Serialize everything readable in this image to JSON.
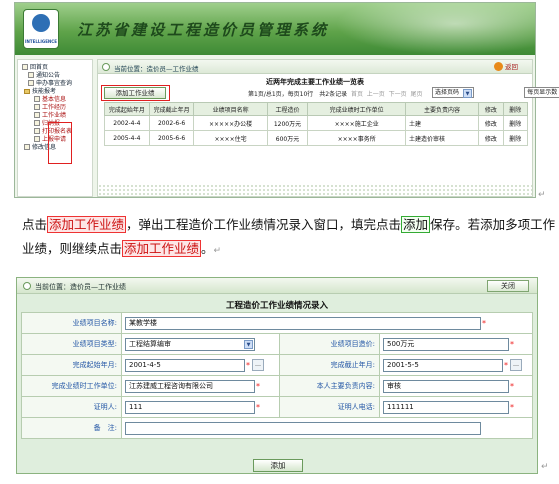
{
  "top_screenshot": {
    "title": "江苏省建设工程造价员管理系统",
    "logo_text": "INTELLIGENCE",
    "sidebar": {
      "items": [
        {
          "label": "回首页"
        },
        {
          "label": "通知公告"
        },
        {
          "label": "申办事宜查询"
        },
        {
          "label": "技能报考"
        },
        {
          "label": "基本信息"
        },
        {
          "label": "工作经历"
        },
        {
          "label": "工作业绩"
        },
        {
          "label": "归纳报"
        },
        {
          "label": "打印报名表"
        },
        {
          "label": "上报申请"
        },
        {
          "label": "修改信息"
        }
      ]
    },
    "breadcrumb": "当前位置：造价员—工作业绩",
    "back_label": "返回",
    "list_title": "近两年完成主要工作业绩一览表",
    "add_button": "添加工作业绩",
    "pager": {
      "info": "第1页/总1页，每页10行　共2条记录",
      "first": "首页",
      "prev": "上一页",
      "next": "下一页",
      "last": "尾页",
      "page_select": "选择页码",
      "page_size": "每页显示数"
    },
    "table": {
      "headers": [
        "完成起始年月",
        "完成截止年月",
        "业绩项目名称",
        "工程造价",
        "完成业绩时工作单位",
        "主要负责内容",
        "修改",
        "删除"
      ],
      "rows": [
        [
          "2002-4-4",
          "2002-6-6",
          "×××××办公楼",
          "1200万元",
          "××××施工企业",
          "土建",
          "修改",
          "删除"
        ],
        [
          "2005-4-4",
          "2005-6-6",
          "××××住宅",
          "600万元",
          "××××事务所",
          "土建造价审核",
          "修改",
          "删除"
        ]
      ]
    }
  },
  "paragraph": {
    "p1": "点击",
    "h1": "添加工作业绩",
    "p2": "，弹出工程造价工作业绩情况录入窗口，填完点击",
    "h2": "添加",
    "p3": "保存。若添加多项工作业绩，则继续点击",
    "h3": "添加工作业绩",
    "p4": "。"
  },
  "bottom_screenshot": {
    "breadcrumb": "当前位置：造价员—工作业绩",
    "close_label": "关闭",
    "form_title": "工程造价工作业绩情况录入",
    "fields": {
      "project_name_label": "业绩项目名称:",
      "project_name_value": "某教学楼",
      "project_type_label": "业绩项目类型:",
      "project_type_value": "工程结算编审",
      "project_cost_label": "业绩项目造价:",
      "project_cost_value": "500万元",
      "start_label": "完成起始年月:",
      "start_value": "2001-4-5",
      "end_label": "完成截止年月:",
      "end_value": "2001-5-5",
      "unit_label": "完成业绩时工作单位:",
      "unit_value": "江苏建威工程咨询有限公司",
      "duty_label": "本人主要负责内容:",
      "duty_value": "审核",
      "witness_label": "证明人:",
      "witness_value": "111",
      "witness_phone_label": "证明人电话:",
      "witness_phone_value": "111111",
      "remark_label": "备　注:",
      "remark_value": ""
    },
    "submit_label": "添加"
  }
}
